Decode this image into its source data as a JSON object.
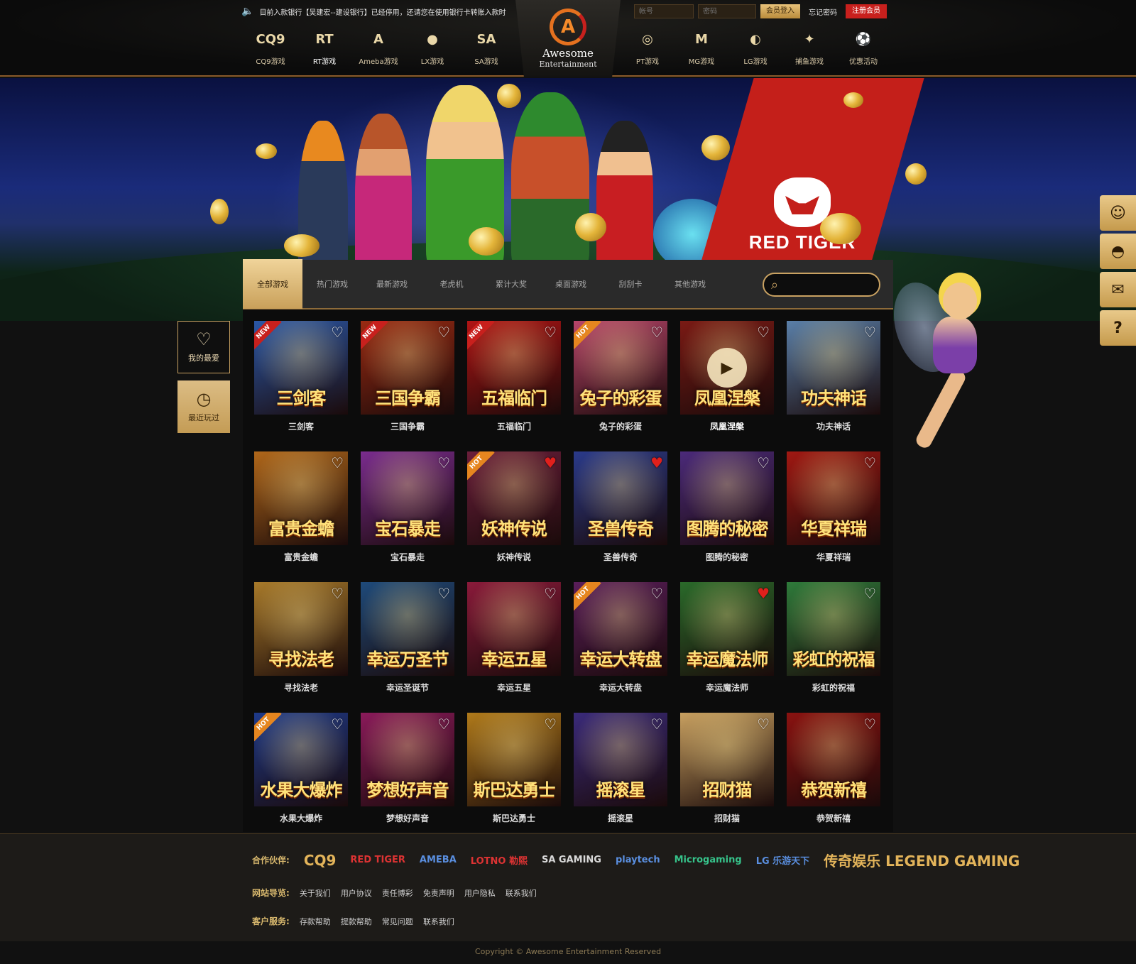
{
  "header": {
    "notice": "目前入款银行【吴建宏--建设银行】已经停用，还请您在使用银行卡转账入款时",
    "login": {
      "username_placeholder": "帐号",
      "password_placeholder": "密码",
      "login_label": "会员登入",
      "forgot_label": "忘记密码",
      "register_label": "注册会员"
    },
    "nav_left": [
      {
        "icon": "CQ9",
        "label": "CQ9游戏"
      },
      {
        "icon": "RT",
        "label": "RT游戏"
      },
      {
        "icon": "A",
        "label": "Ameba游戏"
      },
      {
        "icon": "●",
        "label": "LX游戏"
      },
      {
        "icon": "SA",
        "label": "SA游戏"
      }
    ],
    "logo": {
      "line1": "Awesome",
      "line2": "Entertainment"
    },
    "nav_right": [
      {
        "icon": "◎",
        "label": "PT游戏"
      },
      {
        "icon": "M",
        "label": "MG游戏"
      },
      {
        "icon": "◐",
        "label": "LG游戏"
      },
      {
        "icon": "✦",
        "label": "捕鱼游戏"
      },
      {
        "icon": "⚽",
        "label": "优惠活动"
      }
    ]
  },
  "banner": {
    "brand": "RED TIGER"
  },
  "sidebar_left": {
    "favorites": "我的最爱",
    "recent": "最近玩过"
  },
  "sidebar_right": [
    "person-icon",
    "qq-icon",
    "mail-icon",
    "help-icon"
  ],
  "tabs": [
    "全部游戏",
    "热门游戏",
    "最新游戏",
    "老虎机",
    "累计大奖",
    "桌面游戏",
    "刮刮卡",
    "其他游戏"
  ],
  "search": {
    "placeholder": ""
  },
  "games": [
    {
      "title": "三剑客",
      "art": "三剑客",
      "badge": "NEW",
      "fav": false,
      "bg": "#2b58a8"
    },
    {
      "title": "三国争霸",
      "art": "三国争霸",
      "badge": "NEW",
      "fav": false,
      "bg": "#9a2a12"
    },
    {
      "title": "五福临门",
      "art": "五福临门",
      "badge": "NEW",
      "fav": false,
      "bg": "#b01414"
    },
    {
      "title": "兔子的彩蛋",
      "art": "兔子的彩蛋",
      "badge": "HOT",
      "fav": false,
      "bg": "#b8456a"
    },
    {
      "title": "凤凰涅槃",
      "art": "凤凰涅槃",
      "badge": "",
      "fav": false,
      "bg": "#7a1a14",
      "play": true
    },
    {
      "title": "功夫神话",
      "art": "功夫神话",
      "badge": "",
      "fav": false,
      "bg": "#5a7fa8"
    },
    {
      "title": "富贵金蟾",
      "art": "富贵金蟾",
      "badge": "",
      "fav": false,
      "bg": "#b0671a"
    },
    {
      "title": "宝石暴走",
      "art": "宝石暴走",
      "badge": "",
      "fav": false,
      "bg": "#7a2c8e"
    },
    {
      "title": "妖神传说",
      "art": "妖神传说",
      "badge": "HOT",
      "fav": true,
      "bg": "#6a1e3a"
    },
    {
      "title": "圣兽传奇",
      "art": "圣兽传奇",
      "badge": "",
      "fav": true,
      "bg": "#2a3a8a"
    },
    {
      "title": "图腾的秘密",
      "art": "图腾的秘密",
      "badge": "",
      "fav": false,
      "bg": "#4b2a7a"
    },
    {
      "title": "华夏祥瑞",
      "art": "华夏祥瑞",
      "badge": "",
      "fav": false,
      "bg": "#a01812"
    },
    {
      "title": "寻找法老",
      "art": "寻找法老",
      "badge": "",
      "fav": false,
      "bg": "#a87a2a"
    },
    {
      "title": "幸运圣诞节",
      "art": "幸运万圣节",
      "badge": "",
      "fav": false,
      "bg": "#1e4a7a"
    },
    {
      "title": "幸运五星",
      "art": "幸运五星",
      "badge": "",
      "fav": false,
      "bg": "#8a1a3a"
    },
    {
      "title": "幸运大转盘",
      "art": "幸运大转盘",
      "badge": "HOT",
      "fav": false,
      "bg": "#5a1e5a"
    },
    {
      "title": "幸运魔法师",
      "art": "幸运魔法师",
      "badge": "",
      "fav": true,
      "bg": "#2a6a2a"
    },
    {
      "title": "彩虹的祝福",
      "art": "彩虹的祝福",
      "badge": "",
      "fav": false,
      "bg": "#2e7a3a"
    },
    {
      "title": "水果大爆炸",
      "art": "水果大爆炸",
      "badge": "HOT",
      "fav": false,
      "bg": "#1e3a8a"
    },
    {
      "title": "梦想好声音",
      "art": "梦想好声音",
      "badge": "",
      "fav": false,
      "bg": "#8a1a5a"
    },
    {
      "title": "斯巴达勇士",
      "art": "斯巴达勇士",
      "badge": "",
      "fav": false,
      "bg": "#b07a1a"
    },
    {
      "title": "摇滚星",
      "art": "摇滚星",
      "badge": "",
      "fav": false,
      "bg": "#3a2a7a"
    },
    {
      "title": "招财猫",
      "art": "招财猫",
      "badge": "",
      "fav": false,
      "bg": "#c8a060"
    },
    {
      "title": "恭贺新禧",
      "art": "恭贺新禧",
      "badge": "",
      "fav": false,
      "bg": "#8a1210"
    }
  ],
  "footer": {
    "partners_label": "合作伙伴:",
    "partners": [
      "CQ9",
      "RED TIGER",
      "AMEBA",
      "LOTNO 勒熙",
      "SA GAMING",
      "playtech",
      "Microgaming",
      "LG 乐游天下",
      "传奇娱乐 LEGEND GAMING"
    ],
    "nav_label": "网站导览:",
    "nav": [
      "关于我们",
      "用户协议",
      "责任博彩",
      "免责声明",
      "用户隐私",
      "联系我们"
    ],
    "service_label": "客户服务:",
    "service": [
      "存款帮助",
      "提款帮助",
      "常见问题",
      "联系我们"
    ],
    "copyright": "Copyright © Awesome Entertainment Reserved"
  }
}
